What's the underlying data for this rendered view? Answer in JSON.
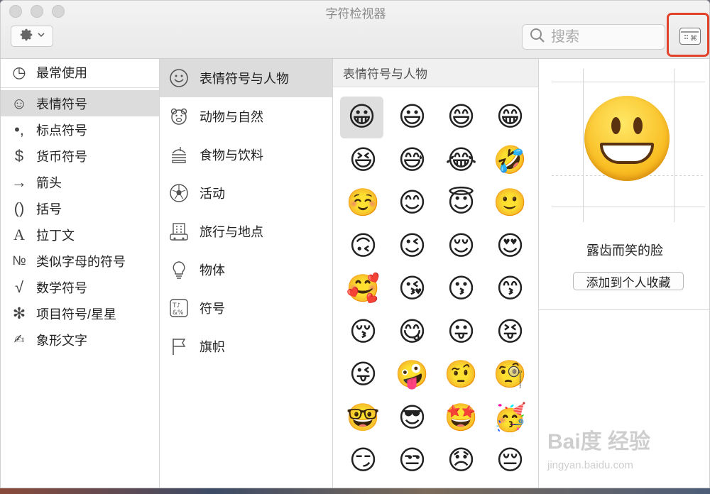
{
  "window": {
    "title": "字符检视器"
  },
  "toolbar": {
    "gear_icon": "gear-icon",
    "search_placeholder": "搜索",
    "viewer_icon": "character-viewer-icon"
  },
  "sidebar": {
    "items": [
      {
        "icon": "clock-icon",
        "glyph": "◷",
        "label": "最常使用"
      },
      {
        "icon": "smiley-icon",
        "glyph": "☺",
        "label": "表情符号"
      },
      {
        "icon": "punctuation-icon",
        "glyph": "•,",
        "label": "标点符号"
      },
      {
        "icon": "dollar-icon",
        "glyph": "$",
        "label": "货币符号"
      },
      {
        "icon": "arrow-icon",
        "glyph": "→",
        "label": "箭头"
      },
      {
        "icon": "parentheses-icon",
        "glyph": "()",
        "label": "括号"
      },
      {
        "icon": "latin-a-icon",
        "glyph": "A",
        "label": "拉丁文"
      },
      {
        "icon": "numero-icon",
        "glyph": "№",
        "label": "类似字母的符号"
      },
      {
        "icon": "sqrt-icon",
        "glyph": "√",
        "label": "数学符号"
      },
      {
        "icon": "asterisk-icon",
        "glyph": "✻",
        "label": "项目符号/星星"
      },
      {
        "icon": "pictograph-icon",
        "glyph": "✍",
        "label": "象形文字"
      }
    ],
    "selected_index": 1
  },
  "categories": {
    "items": [
      {
        "icon": "smiley-icon",
        "glyph": "☺",
        "label": "表情符号与人物"
      },
      {
        "icon": "bear-icon",
        "glyph": "🐻",
        "label": "动物与自然"
      },
      {
        "icon": "burger-icon",
        "glyph": "🍔",
        "label": "食物与饮料"
      },
      {
        "icon": "soccer-ball-icon",
        "glyph": "⚽",
        "label": "活动"
      },
      {
        "icon": "building-icon",
        "glyph": "🏢",
        "label": "旅行与地点"
      },
      {
        "icon": "lightbulb-icon",
        "glyph": "💡",
        "label": "物体"
      },
      {
        "icon": "symbols-icon",
        "glyph": "♫",
        "label": "符号"
      },
      {
        "icon": "flag-icon",
        "glyph": "⚐",
        "label": "旗帜"
      }
    ],
    "selected_index": 0
  },
  "grid": {
    "header": "表情符号与人物",
    "emojis": [
      "😀",
      "😃",
      "😄",
      "😁",
      "😆",
      "😅",
      "😂",
      "🤣",
      "☺️",
      "😊",
      "😇",
      "🙂",
      "🙃",
      "😉",
      "😌",
      "😍",
      "🥰",
      "😘",
      "😗",
      "😙",
      "😚",
      "😋",
      "😛",
      "😝",
      "😜",
      "🤪",
      "🤨",
      "🧐",
      "🤓",
      "😎",
      "🤩",
      "🥳",
      "😏",
      "😒",
      "😞",
      "😔"
    ],
    "selected_index": 0
  },
  "preview": {
    "char": "😀",
    "name": "露齿而笑的脸",
    "add_favorite_label": "添加到个人收藏"
  },
  "watermark": {
    "brand": "Bai度 经验",
    "url": "jingyan.baidu.com"
  }
}
